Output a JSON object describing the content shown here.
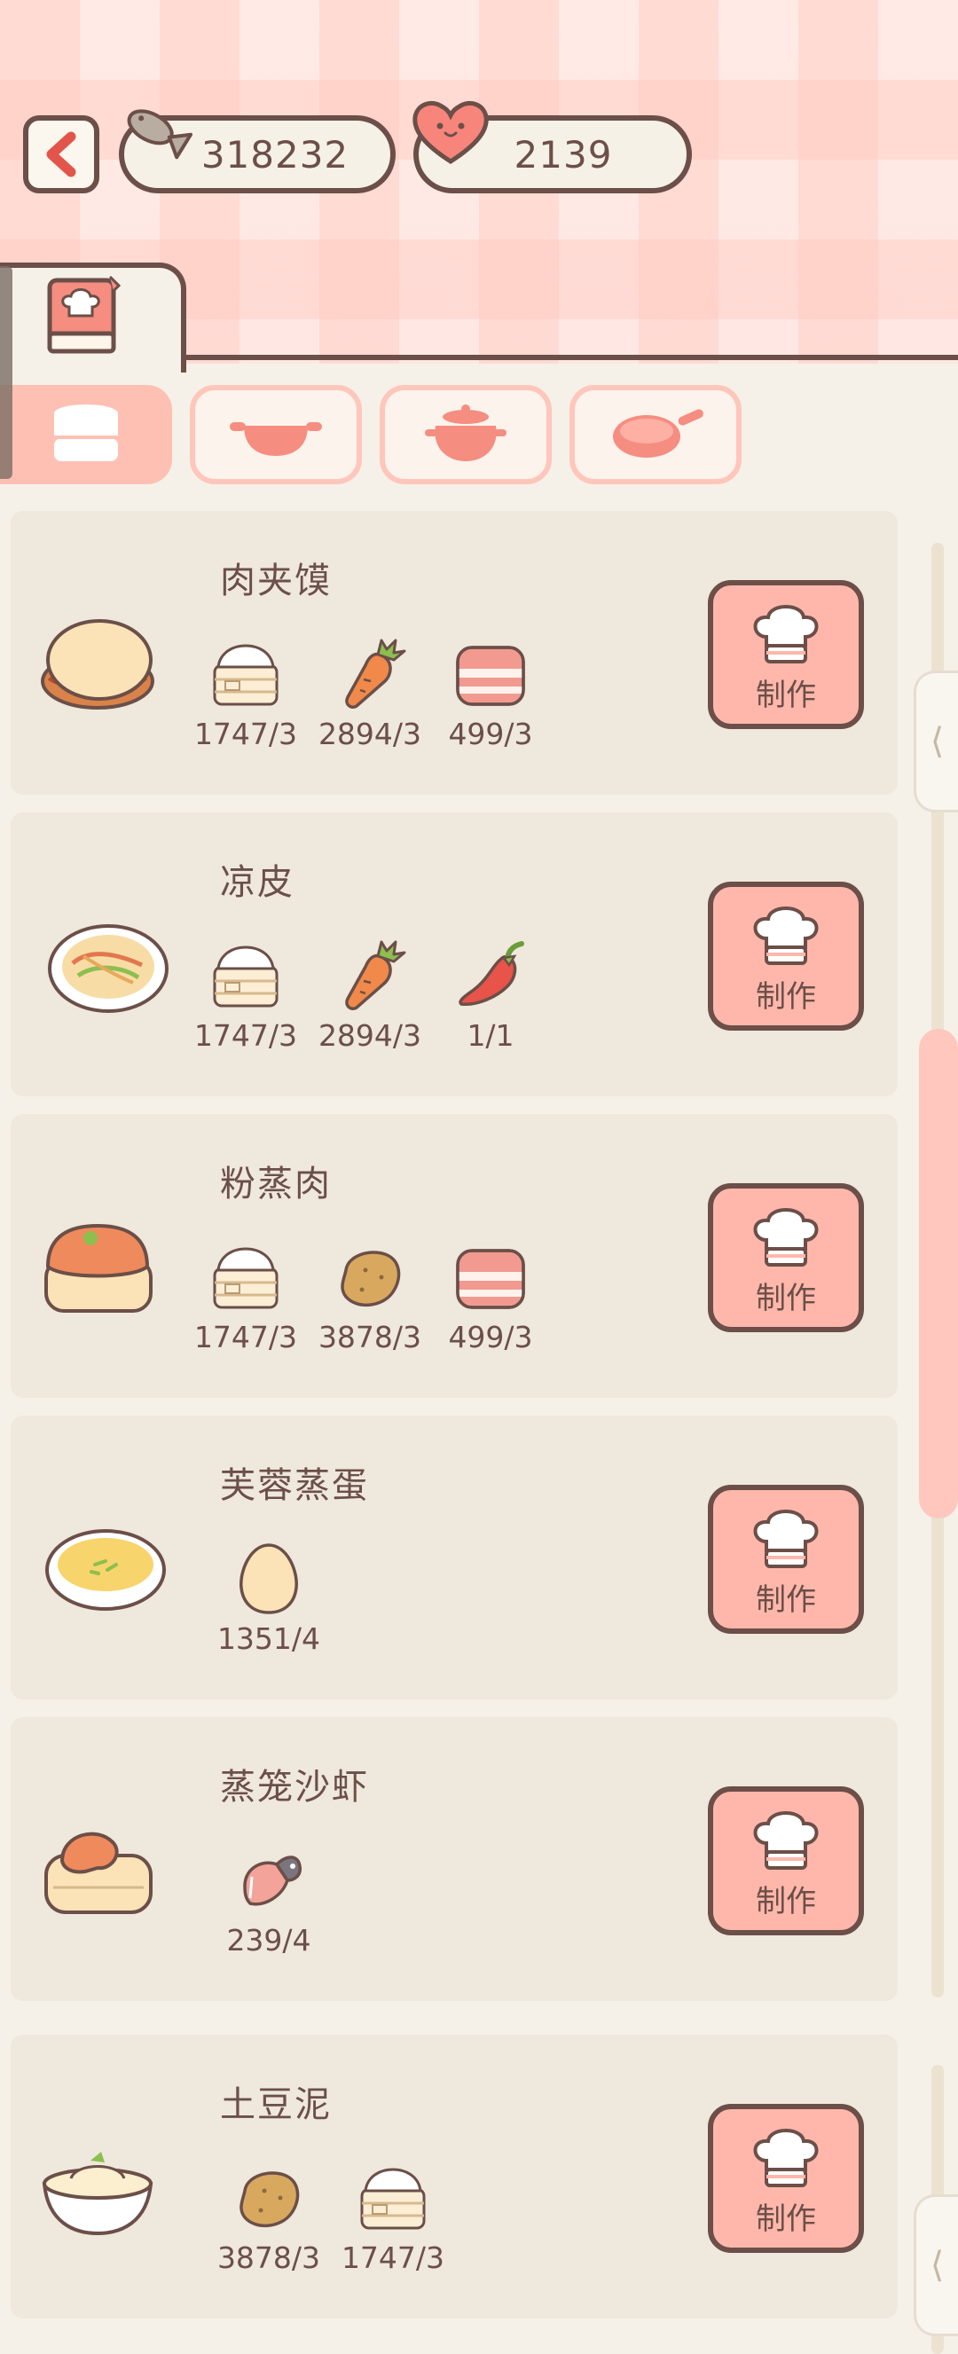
{
  "header": {
    "currencies": [
      {
        "icon": "fish-icon",
        "value": "318232"
      },
      {
        "icon": "heart-icon",
        "value": "2139"
      }
    ]
  },
  "tabs": {
    "main": {
      "icon": "recipe-book-icon"
    },
    "sub": [
      {
        "icon": "steamer-icon",
        "active": true
      },
      {
        "icon": "wok-icon",
        "active": false
      },
      {
        "icon": "clay-pot-icon",
        "active": false
      },
      {
        "icon": "frying-pan-icon",
        "active": false
      }
    ]
  },
  "recipes": [
    {
      "name": "肉夹馍",
      "dish_icon": "roujiamo-icon",
      "ingredients": [
        {
          "icon": "flour-icon",
          "count": "1747/3"
        },
        {
          "icon": "carrot-icon",
          "count": "2894/3"
        },
        {
          "icon": "bacon-icon",
          "count": "499/3"
        }
      ],
      "button": "制作"
    },
    {
      "name": "凉皮",
      "dish_icon": "liangpi-icon",
      "ingredients": [
        {
          "icon": "flour-icon",
          "count": "1747/3"
        },
        {
          "icon": "carrot-icon",
          "count": "2894/3"
        },
        {
          "icon": "chili-icon",
          "count": "1/1"
        }
      ],
      "button": "制作"
    },
    {
      "name": "粉蒸肉",
      "dish_icon": "steamed-pork-icon",
      "ingredients": [
        {
          "icon": "flour-icon",
          "count": "1747/3"
        },
        {
          "icon": "potato-icon",
          "count": "3878/3"
        },
        {
          "icon": "bacon-icon",
          "count": "499/3"
        }
      ],
      "button": "制作"
    },
    {
      "name": "芙蓉蒸蛋",
      "dish_icon": "steamed-egg-icon",
      "ingredients": [
        {
          "icon": "egg-icon",
          "count": "1351/4"
        }
      ],
      "button": "制作"
    },
    {
      "name": "蒸笼沙虾",
      "dish_icon": "steamed-shrimp-icon",
      "ingredients": [
        {
          "icon": "fish-meat-icon",
          "count": "239/4"
        }
      ],
      "button": "制作"
    },
    {
      "name": "土豆泥",
      "dish_icon": "mashed-potato-icon",
      "ingredients": [
        {
          "icon": "potato-icon",
          "count": "3878/3"
        },
        {
          "icon": "flour-icon",
          "count": "1747/3"
        }
      ],
      "button": "制作"
    }
  ],
  "side_handle_glyph": "⟨",
  "colors": {
    "outline": "#6b4f48",
    "accent_pink": "#ffb7ab",
    "card_bg": "#efe8dc",
    "page_bg": "#f5f1e8"
  }
}
